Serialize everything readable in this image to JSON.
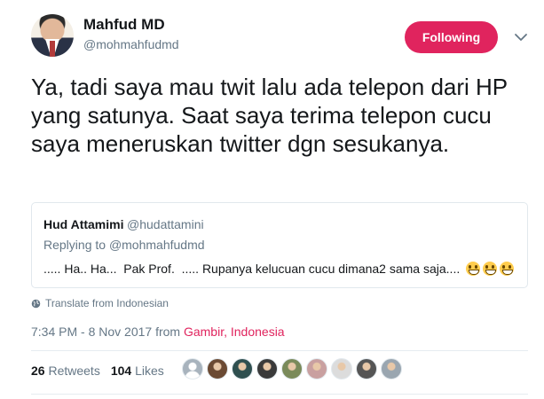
{
  "author": {
    "name": "Mahfud MD",
    "handle": "@mohmahfudmd"
  },
  "follow_button": {
    "label": "Following",
    "color": "#e0245e"
  },
  "tweet": {
    "text": "Ya, tadi saya mau twit lalu ada telepon dari HP yang satunya. Saat saya terima telepon cucu saya meneruskan twitter dgn sesukanya."
  },
  "quoted_tweet": {
    "name": "Hud Attamimi",
    "handle": "@hudattamini",
    "replying_prefix": "Replying to ",
    "replying_to": "@mohmahfudmd",
    "text": "..... Ha.. Ha...  Pak Prof.  ..... Rupanya kelucuan cucu dimana2 sama saja.... ",
    "emoji": [
      "grinning-face-icon",
      "grinning-face-icon",
      "grinning-face-icon"
    ]
  },
  "translate_label": "Translate from Indonesian",
  "timestamp": {
    "time": "7:34 PM - 8 Nov 2017 from ",
    "location": "Gambir, Indonesia"
  },
  "stats": {
    "retweets_count": "26",
    "retweets_label": " Retweets",
    "likes_count": "104",
    "likes_label": " Likes"
  },
  "likers": [
    {
      "icon": "default-avatar-icon",
      "color": "#a8b3bd"
    },
    {
      "icon": "user-avatar-icon",
      "color": "#6b4a33"
    },
    {
      "icon": "user-avatar-icon",
      "color": "#2f4f4f"
    },
    {
      "icon": "user-avatar-icon",
      "color": "#3a3a3a"
    },
    {
      "icon": "user-avatar-icon",
      "color": "#7a8a5a"
    },
    {
      "icon": "user-avatar-icon",
      "color": "#c9a0a0"
    },
    {
      "icon": "user-avatar-icon",
      "color": "#dcdcdc"
    },
    {
      "icon": "user-avatar-icon",
      "color": "#555555"
    },
    {
      "icon": "user-avatar-icon",
      "color": "#9aa6b0"
    }
  ]
}
